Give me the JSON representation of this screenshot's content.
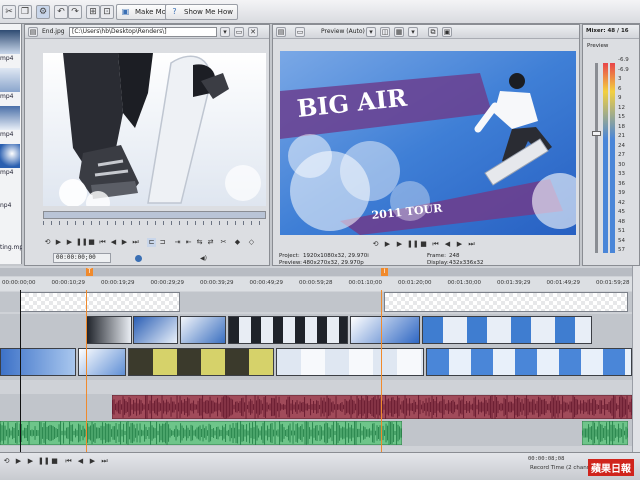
{
  "toolbar": {
    "make_movie_label": "Make Movie",
    "show_me_how_label": "Show Me How"
  },
  "media_list": {
    "items": [
      "mp4",
      "mp4",
      "mp4",
      "mp4",
      "np4",
      "ting.mp3"
    ]
  },
  "trimmer": {
    "file_label": "End.jpg",
    "path": "[C:\\Users\\hb\\Desktop\\Renders\\]",
    "timecode": "00:00:00;00"
  },
  "preview": {
    "mode_label": "Preview (Auto)",
    "overlay_title": "BIG AIR",
    "overlay_subtitle": "2011 TOUR",
    "project_label": "Project:",
    "project_value": "1920x1080x32, 29.970i",
    "preview_label": "Preview:",
    "preview_value": "480x270x32, 29.970p",
    "frame_label": "Frame:",
    "frame_value": "248",
    "display_label": "Display:",
    "display_value": "432x336x32"
  },
  "mixer": {
    "title": "Mixer: 48 / 16",
    "sub_label": "Preview",
    "scale": [
      "-6.9",
      "-6.9",
      "3",
      "6",
      "9",
      "12",
      "15",
      "18",
      "21",
      "24",
      "27",
      "30",
      "33",
      "36",
      "39",
      "42",
      "45",
      "48",
      "51",
      "54",
      "57"
    ]
  },
  "timeline": {
    "ruler": [
      "00:00:00;00",
      "00:00:10;29",
      "00:00:19;29",
      "00:00:29;29",
      "00:00:39;29",
      "00:00:49;29",
      "00:00:59;28",
      "00:01:10;00",
      "00:01:20;00",
      "00:01:30;00",
      "00:01:39;29",
      "00:01:49;29",
      "00:01:59;28"
    ],
    "playhead_marker": "T",
    "region_marker": "I"
  },
  "status": {
    "timecode": "00:00:08;08",
    "record_time": "Record Time (2 channels): 11:29:00"
  },
  "watermark": "蘋果日報",
  "colors": {
    "accent": "#3a6fb4",
    "audio_red": "#8b2f3f",
    "audio_green": "#4fb168",
    "preview_purple": "#6b3f8f",
    "sky_blue": "#4d86d6"
  }
}
